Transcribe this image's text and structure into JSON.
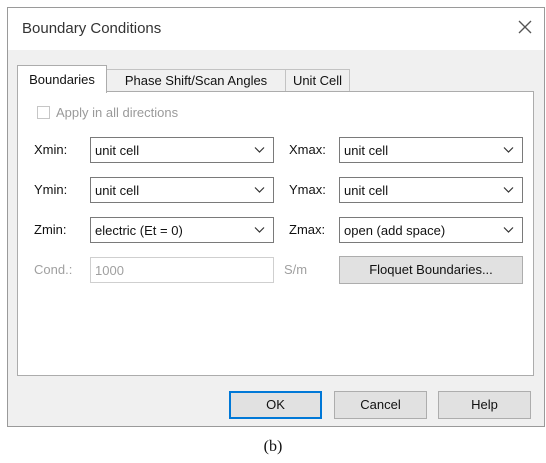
{
  "window": {
    "title": "Boundary Conditions",
    "close_icon": "close-icon"
  },
  "tabs": [
    {
      "label": "Boundaries",
      "active": true
    },
    {
      "label": "Phase Shift/Scan Angles",
      "active": false
    },
    {
      "label": "Unit Cell",
      "active": false
    }
  ],
  "boundaries": {
    "apply_all_label": "Apply in all directions",
    "apply_all_checked": false,
    "xmin": {
      "label": "Xmin:",
      "value": "unit cell"
    },
    "xmax": {
      "label": "Xmax:",
      "value": "unit cell"
    },
    "ymin": {
      "label": "Ymin:",
      "value": "unit cell"
    },
    "ymax": {
      "label": "Ymax:",
      "value": "unit cell"
    },
    "zmin": {
      "label": "Zmin:",
      "value": "electric (Et = 0)"
    },
    "zmax": {
      "label": "Zmax:",
      "value": "open (add space)"
    },
    "cond": {
      "label": "Cond.:",
      "value": "1000",
      "unit": "S/m"
    },
    "floquet_button": "Floquet Boundaries..."
  },
  "footer": {
    "ok": "OK",
    "cancel": "Cancel",
    "help": "Help"
  },
  "caption": "(b)",
  "colors": {
    "default_button_border": "#0078d7",
    "dialog_background": "#f0f0f0",
    "disabled_text": "#a0a0a0"
  }
}
